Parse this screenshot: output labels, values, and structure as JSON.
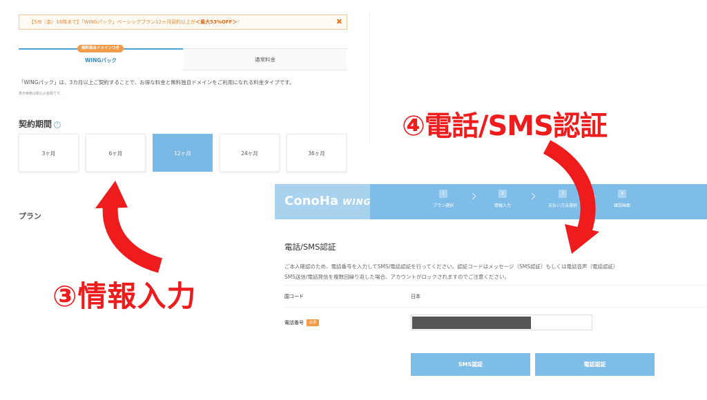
{
  "left": {
    "banner": {
      "prefix": "【5/9（金）16時まで】「WINGパック」ベーシックプラン12ヶ月契約以上が",
      "highlight": "＜最大53%OFF＞",
      "suffix": "！",
      "close": "✖"
    },
    "tabs": {
      "badge": "無料独自ドメインつき",
      "wing": "WINGパック",
      "normal": "通常料金"
    },
    "description": "「WINGパック」は、3カ月以上ご契約することで、お得な料金と無料独自ドメインをご利用になれる料金タイプです。",
    "price_note": "表示価格は税込み金額です。",
    "period_title": "契約期間",
    "help": "?",
    "periods": [
      "3ヶ月",
      "6ヶ月",
      "12ヶ月",
      "24ヶ月",
      "36ヶ月"
    ],
    "selected_period": "12ヶ月",
    "plan_title": "プラン"
  },
  "right": {
    "logo": "ConoHa",
    "logo_sub": "WING",
    "steps": [
      {
        "num": "1",
        "label": "プラン選択"
      },
      {
        "num": "2",
        "label": "情報入力"
      },
      {
        "num": "3",
        "label": "支払い方法選択"
      },
      {
        "num": "4",
        "label": "確認画面"
      }
    ],
    "title": "電話/SMS認証",
    "desc_line1": "ご本人確認のため、電話番号を入力してSMS/電話認証を行ってください。認証コードはメッセージ（SMS認証）もしくは電話音声（電話認証）",
    "desc_line2": "SMS送信/電話発信を複数回繰り返した場合、アカウントがロックされますのでご注意ください。",
    "country_label": "国コード",
    "country_value": "日本",
    "phone_label": "電話番号",
    "required": "必須",
    "sms_button": "SMS認証",
    "phone_button": "電話認証"
  },
  "annotations": {
    "step3": "③情報入力",
    "step4": "④電話/SMS認証",
    "color": "#ee1c1c"
  },
  "colors": {
    "accent_blue": "#7ebde8",
    "orange": "#f29a47"
  }
}
